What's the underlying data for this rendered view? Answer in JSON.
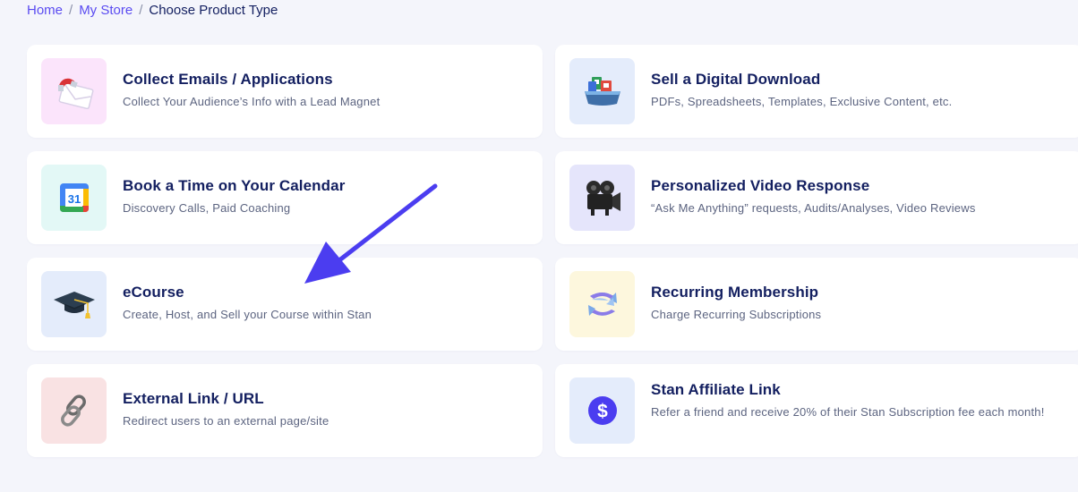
{
  "breadcrumb": {
    "home": "Home",
    "store": "My Store",
    "current": "Choose Product Type"
  },
  "cards": [
    {
      "title": "Collect Emails / Applications",
      "desc": "Collect Your Audience’s Info with a Lead Magnet",
      "icon": "magnet-envelope-icon",
      "bg": "#fbe4fb"
    },
    {
      "title": "Sell a Digital Download",
      "desc": "PDFs, Spreadsheets, Templates, Exclusive Content, etc.",
      "icon": "download-tray-icon",
      "bg": "#e4ecfb"
    },
    {
      "title": "Book a Time on Your Calendar",
      "desc": "Discovery Calls, Paid Coaching",
      "icon": "calendar-icon",
      "bg": "#e3f8f6"
    },
    {
      "title": "Personalized Video Response",
      "desc": "“Ask Me Anything” requests, Audits/Analyses, Video Reviews",
      "icon": "video-camera-icon",
      "bg": "#e5e5fb"
    },
    {
      "title": "eCourse",
      "desc": "Create, Host, and Sell your Course within Stan",
      "icon": "graduation-cap-icon",
      "bg": "#e4ecfb"
    },
    {
      "title": "Recurring Membership",
      "desc": "Charge Recurring Subscriptions",
      "icon": "recurring-arrows-icon",
      "bg": "#fdf7dd"
    },
    {
      "title": "External Link / URL",
      "desc": "Redirect users to an external page/site",
      "icon": "chain-link-icon",
      "bg": "#f9e2e3"
    },
    {
      "title": "Stan Affiliate Link",
      "desc": "Refer a friend and receive 20% of their Stan Subscription fee each month!",
      "icon": "dollar-coin-icon",
      "bg": "#e4ecfb"
    }
  ],
  "colors": {
    "page_bg": "#f4f5fb",
    "link": "#5a4bf1",
    "title": "#131f60",
    "desc": "#5c6480",
    "annotation_arrow": "#4b3df0"
  }
}
